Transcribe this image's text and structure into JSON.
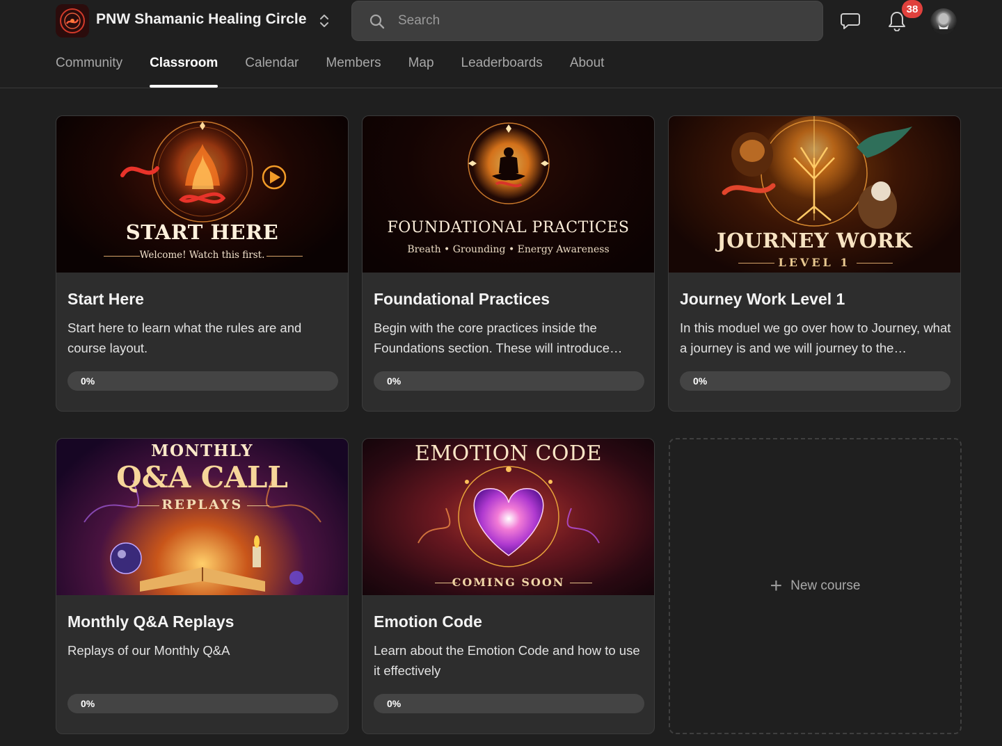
{
  "header": {
    "community_name": "PNW Shamanic Healing Circle",
    "search_placeholder": "Search",
    "notification_count": "38"
  },
  "tabs": [
    {
      "label": "Community",
      "active": false
    },
    {
      "label": "Classroom",
      "active": true
    },
    {
      "label": "Calendar",
      "active": false
    },
    {
      "label": "Members",
      "active": false
    },
    {
      "label": "Map",
      "active": false
    },
    {
      "label": "Leaderboards",
      "active": false
    },
    {
      "label": "About",
      "active": false
    }
  ],
  "courses": [
    {
      "title": "Start Here",
      "description": "Start here to learn what the rules are and course layout.",
      "progress_label": "0%",
      "progress": 0,
      "thumb": {
        "line1": "START HERE",
        "line2": "Welcome! Watch this first."
      }
    },
    {
      "title": "Foundational Practices",
      "description": "Begin with the core practices inside the Foundations section. These will introduce…",
      "progress_label": "0%",
      "progress": 0,
      "thumb": {
        "line1": "FOUNDATIONAL PRACTICES",
        "line2": "Breath • Grounding • Energy Awareness"
      }
    },
    {
      "title": "Journey Work Level 1",
      "description": "In this moduel we go over how to Journey, what a journey is and we will journey to the…",
      "progress_label": "0%",
      "progress": 0,
      "thumb": {
        "line1": "JOURNEY WORK",
        "line2": "LEVEL 1"
      }
    },
    {
      "title": "Monthly Q&A Replays",
      "description": "Replays of our Monthly Q&A",
      "progress_label": "0%",
      "progress": 0,
      "thumb": {
        "line1": "MONTHLY",
        "line2": "Q&A CALL",
        "line3": "REPLAYS"
      }
    },
    {
      "title": "Emotion Code",
      "description": "Learn about the Emotion Code and how to use it effectively",
      "progress_label": "0%",
      "progress": 0,
      "thumb": {
        "line1": "EMOTION CODE",
        "line2": "COMING SOON"
      }
    }
  ],
  "new_course_label": "New course",
  "colors": {
    "background": "#1f1f1f",
    "card": "#2d2d2d",
    "badge": "#e0413d"
  }
}
